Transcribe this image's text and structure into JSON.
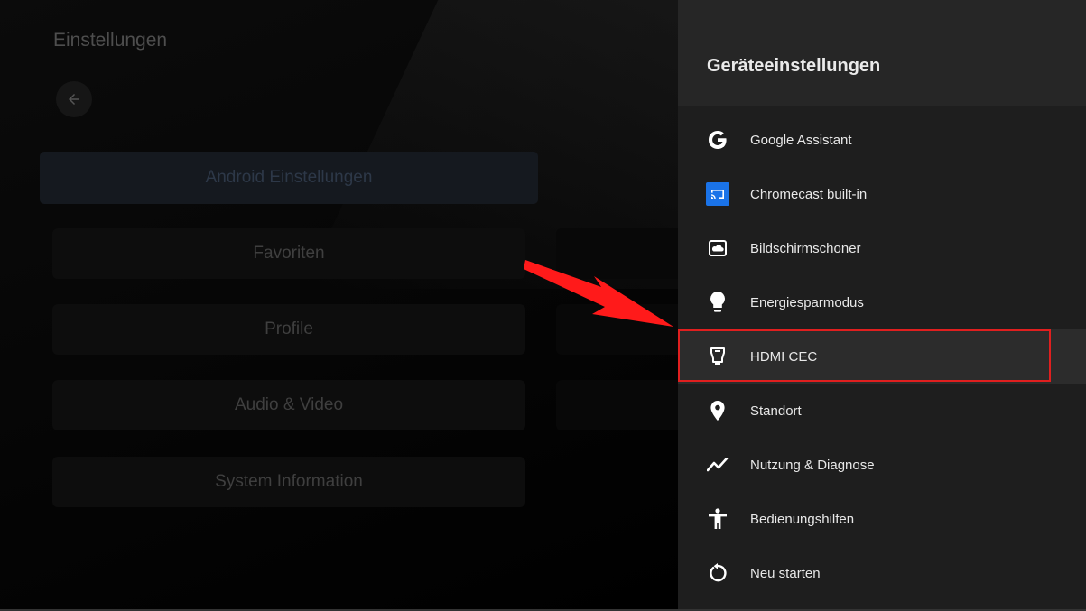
{
  "left": {
    "title": "Einstellungen",
    "menu": [
      {
        "label": "Android Einstellungen"
      },
      {
        "label": "Favoriten"
      },
      {
        "label": "Profile"
      },
      {
        "label": "Audio & Video"
      },
      {
        "label": "System Information"
      }
    ]
  },
  "panel": {
    "title": "Geräteeinstellungen",
    "items": [
      {
        "label": "Google Assistant",
        "icon": "google-g-icon"
      },
      {
        "label": "Chromecast built-in",
        "icon": "cast-icon"
      },
      {
        "label": "Bildschirmschoner",
        "icon": "screensaver-icon"
      },
      {
        "label": "Energiesparmodus",
        "icon": "lightbulb-icon"
      },
      {
        "label": "HDMI CEC",
        "icon": "hdmi-plug-icon"
      },
      {
        "label": "Standort",
        "icon": "location-pin-icon"
      },
      {
        "label": "Nutzung & Diagnose",
        "icon": "trend-line-icon"
      },
      {
        "label": "Bedienungshilfen",
        "icon": "accessibility-icon"
      },
      {
        "label": "Neu starten",
        "icon": "restart-icon"
      }
    ]
  },
  "colors": {
    "highlight": "#e01f1f",
    "cast_icon_bg": "#1a73e8",
    "panel_bg": "#1e1e1e"
  }
}
